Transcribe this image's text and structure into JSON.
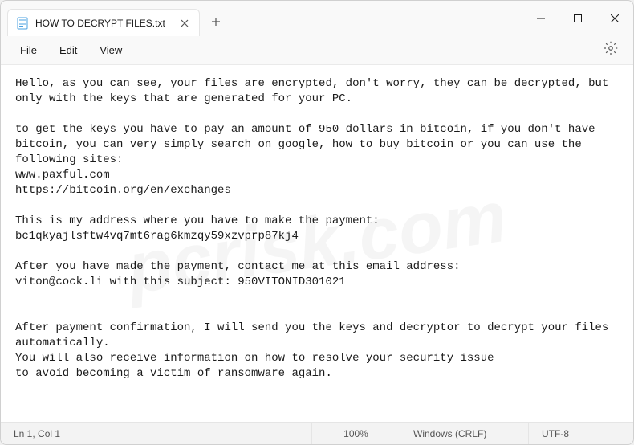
{
  "tab": {
    "title": "HOW TO DECRYPT FILES.txt"
  },
  "menu": {
    "file": "File",
    "edit": "Edit",
    "view": "View"
  },
  "content": "Hello, as you can see, your files are encrypted, don't worry, they can be decrypted, but only with the keys that are generated for your PC.\n\nto get the keys you have to pay an amount of 950 dollars in bitcoin, if you don't have bitcoin, you can very simply search on google, how to buy bitcoin or you can use the following sites:\nwww.paxful.com\nhttps://bitcoin.org/en/exchanges\n\nThis is my address where you have to make the payment:\nbc1qkyajlsftw4vq7mt6rag6kmzqy59xzvprp87kj4\n\nAfter you have made the payment, contact me at this email address:\nviton@cock.li with this subject: 950VITONID301021\n\n\nAfter payment confirmation, I will send you the keys and decryptor to decrypt your files automatically.\nYou will also receive information on how to resolve your security issue\nto avoid becoming a victim of ransomware again.",
  "status": {
    "position": "Ln 1, Col 1",
    "zoom": "100%",
    "line_ending": "Windows (CRLF)",
    "encoding": "UTF-8"
  }
}
